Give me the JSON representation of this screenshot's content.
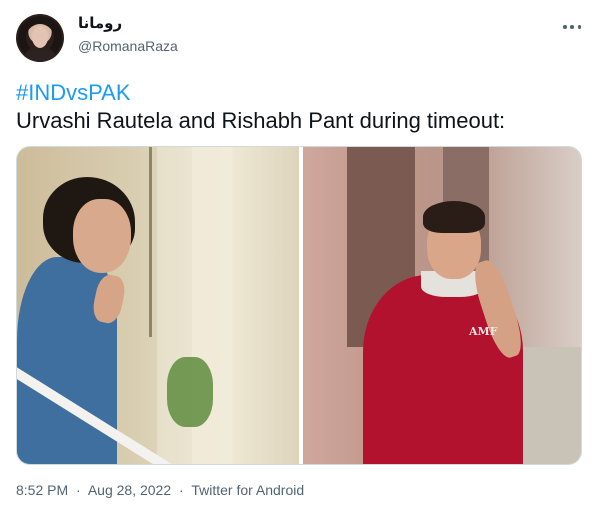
{
  "user": {
    "display_name": "رومانا",
    "handle": "@RomanaRaza"
  },
  "tweet": {
    "hashtag": "#INDvsPAK",
    "text": "Urvashi Rautela and Rishabh Pant during timeout:",
    "media": {
      "left_panel_icon": "photo-woman-balcony-waving",
      "right_panel_icon": "photo-man-red-polo-shirt",
      "shirt_logo_text": "AMF"
    }
  },
  "footer": {
    "time": "8:52 PM",
    "separator": "·",
    "date": "Aug 28, 2022",
    "source": "Twitter for Android"
  },
  "colors": {
    "link": "#1d9bf0",
    "secondary_text": "#536471",
    "primary_text": "#0f1419"
  },
  "icons": {
    "more": "more-horizontal-icon"
  }
}
